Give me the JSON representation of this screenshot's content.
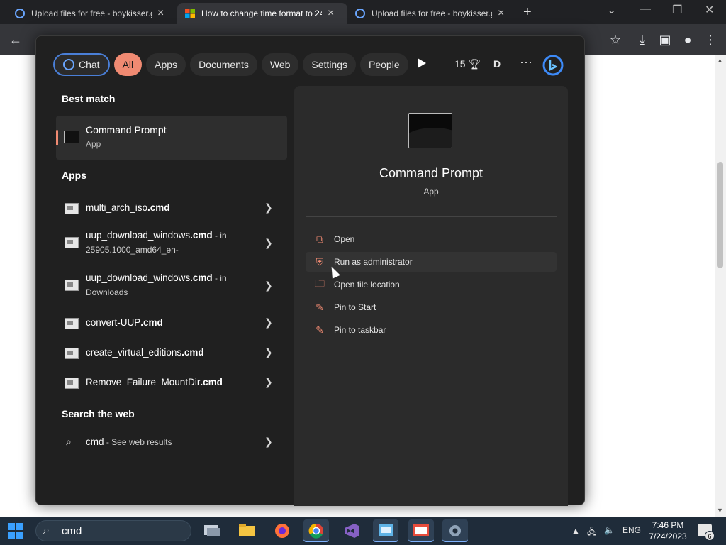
{
  "browser": {
    "tabs": [
      {
        "title": "Upload files for free - boykisser.g",
        "icon": "cloud-icon"
      },
      {
        "title": "How to change time format to 24",
        "icon": "microsoft-logo-icon"
      },
      {
        "title": "Upload files for free - boykisser.g",
        "icon": "cloud-icon"
      }
    ]
  },
  "search_panel": {
    "chips": [
      "Chat",
      "All",
      "Apps",
      "Documents",
      "Web",
      "Settings",
      "People"
    ],
    "points": "15",
    "user_initial": "D",
    "best_match_title": "Best match",
    "best_match": {
      "name": "Command Prompt",
      "type": "App"
    },
    "apps_title": "Apps",
    "apps": [
      {
        "name_plain": "multi_arch_iso",
        "name_bold": ".cmd",
        "suffix": "",
        "sub": ""
      },
      {
        "name_plain": "uup_download_windows",
        "name_bold": ".cmd",
        "suffix": " - in",
        "sub": "25905.1000_amd64_en-"
      },
      {
        "name_plain": "uup_download_windows",
        "name_bold": ".cmd",
        "suffix": " - in",
        "sub": "Downloads"
      },
      {
        "name_plain": "convert-UUP",
        "name_bold": ".cmd",
        "suffix": "",
        "sub": ""
      },
      {
        "name_plain": "create_virtual_editions",
        "name_bold": ".cmd",
        "suffix": "",
        "sub": ""
      },
      {
        "name_plain": "Remove_Failure_MountDir",
        "name_bold": ".cmd",
        "suffix": "",
        "sub": ""
      }
    ],
    "web_title": "Search the web",
    "web_result": {
      "query": "cmd",
      "suffix": " - See web results"
    },
    "detail": {
      "name": "Command Prompt",
      "type": "App",
      "actions": [
        {
          "label": "Open",
          "icon": "open-icon"
        },
        {
          "label": "Run as administrator",
          "icon": "shield-icon"
        },
        {
          "label": "Open file location",
          "icon": "folder-icon"
        },
        {
          "label": "Pin to Start",
          "icon": "pin-icon"
        },
        {
          "label": "Pin to taskbar",
          "icon": "pin-icon"
        }
      ]
    }
  },
  "taskbar": {
    "search_value": "cmd",
    "language": "ENG",
    "time": "7:46 PM",
    "date": "7/24/2023",
    "notification_count": "6"
  },
  "colors": {
    "accent": "#f08a72",
    "panel_bg": "#202020",
    "detail_bg": "#2b2b2b",
    "taskbar_bg": "#1f2c3a"
  }
}
